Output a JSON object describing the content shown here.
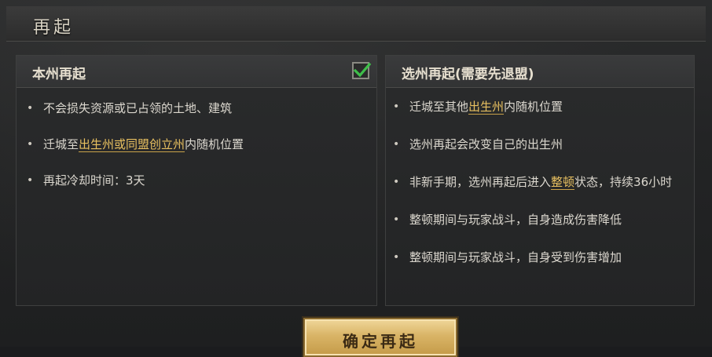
{
  "dialog": {
    "title": "再起"
  },
  "left_panel": {
    "title": "本州再起",
    "selected": true,
    "check_icon": "checkmark-icon",
    "items": [
      {
        "parts": [
          {
            "text": "不会损失资源或已占领的土地、建筑",
            "highlight": false
          }
        ]
      },
      {
        "parts": [
          {
            "text": "迁城至",
            "highlight": false
          },
          {
            "text": "出生州或同盟创立州",
            "highlight": true
          },
          {
            "text": "内随机位置",
            "highlight": false
          }
        ]
      },
      {
        "parts": [
          {
            "text": "再起冷却时间：3天",
            "highlight": false
          }
        ]
      }
    ]
  },
  "right_panel": {
    "title": "选州再起(需要先退盟)",
    "items": [
      {
        "parts": [
          {
            "text": "迁城至其他",
            "highlight": false
          },
          {
            "text": "出生州",
            "highlight": true
          },
          {
            "text": "内随机位置",
            "highlight": false
          }
        ]
      },
      {
        "parts": [
          {
            "text": "选州再起会改变自己的出生州",
            "highlight": false
          }
        ]
      },
      {
        "parts": [
          {
            "text": "非新手期，选州再起后进入",
            "highlight": false
          },
          {
            "text": "整顿",
            "highlight": true
          },
          {
            "text": "状态，持续36小时",
            "highlight": false
          }
        ]
      },
      {
        "parts": [
          {
            "text": "整顿期间与玩家战斗，自身造成伤害降低",
            "highlight": false
          }
        ]
      },
      {
        "parts": [
          {
            "text": "整顿期间与玩家战斗，自身受到伤害增加",
            "highlight": false
          }
        ]
      }
    ]
  },
  "confirm_button": {
    "label": "确定再起"
  },
  "colors": {
    "highlight": "#e8c060",
    "text": "#dcd8cf",
    "check": "#3fbf4a",
    "button_gold": "#d9b466"
  }
}
